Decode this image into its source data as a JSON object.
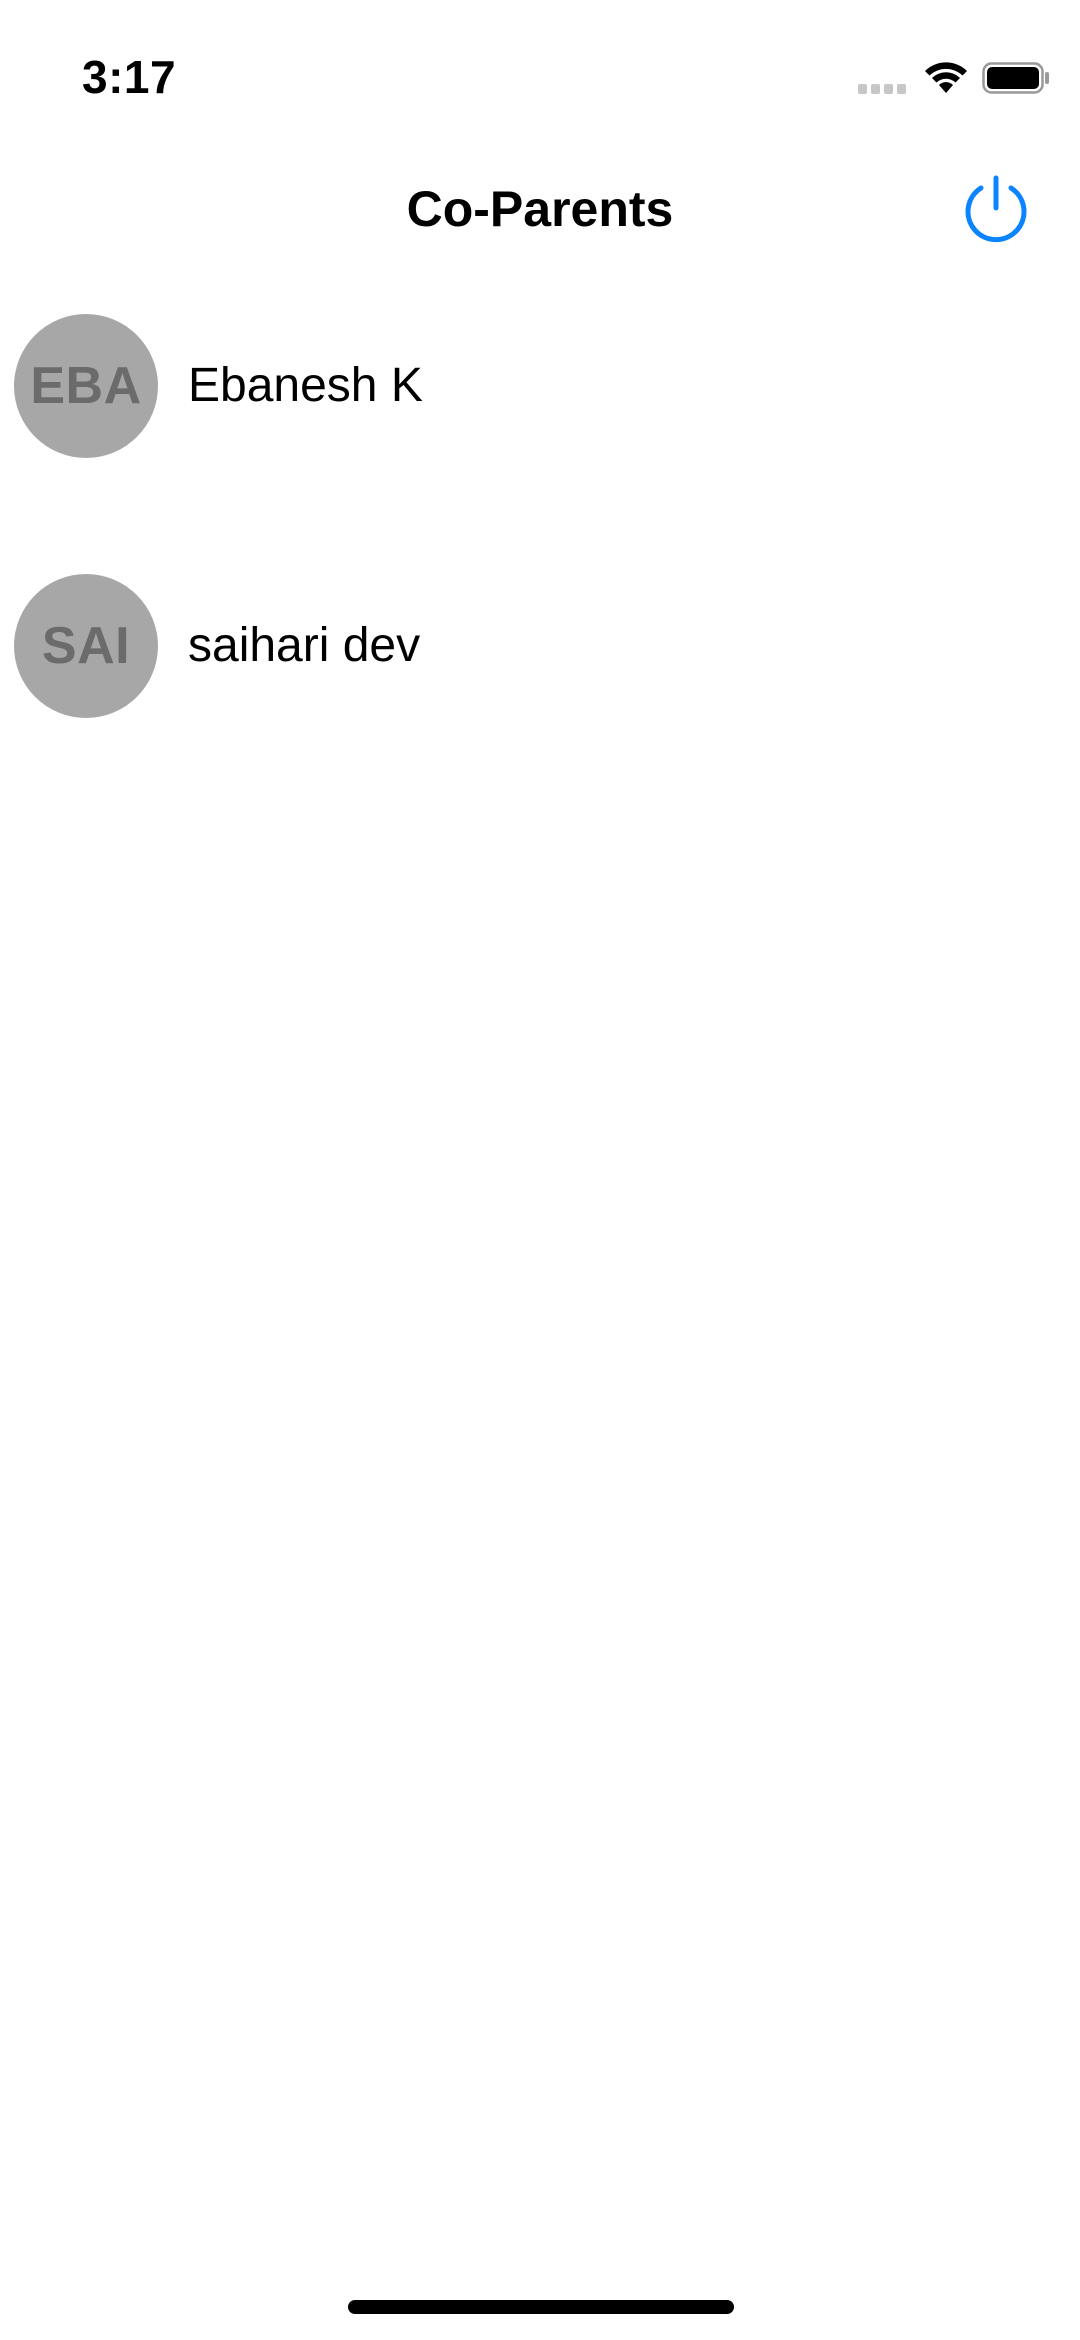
{
  "status_bar": {
    "time": "3:17"
  },
  "nav": {
    "title": "Co-Parents",
    "power_icon": "power-icon",
    "accent_color": "#0a84ff"
  },
  "contacts": [
    {
      "initials": "EBA",
      "name": "Ebanesh K"
    },
    {
      "initials": "SAI",
      "name": "saihari dev"
    }
  ],
  "colors": {
    "avatar_bg": "#a7a7a7",
    "avatar_text": "#6b6b6b"
  }
}
